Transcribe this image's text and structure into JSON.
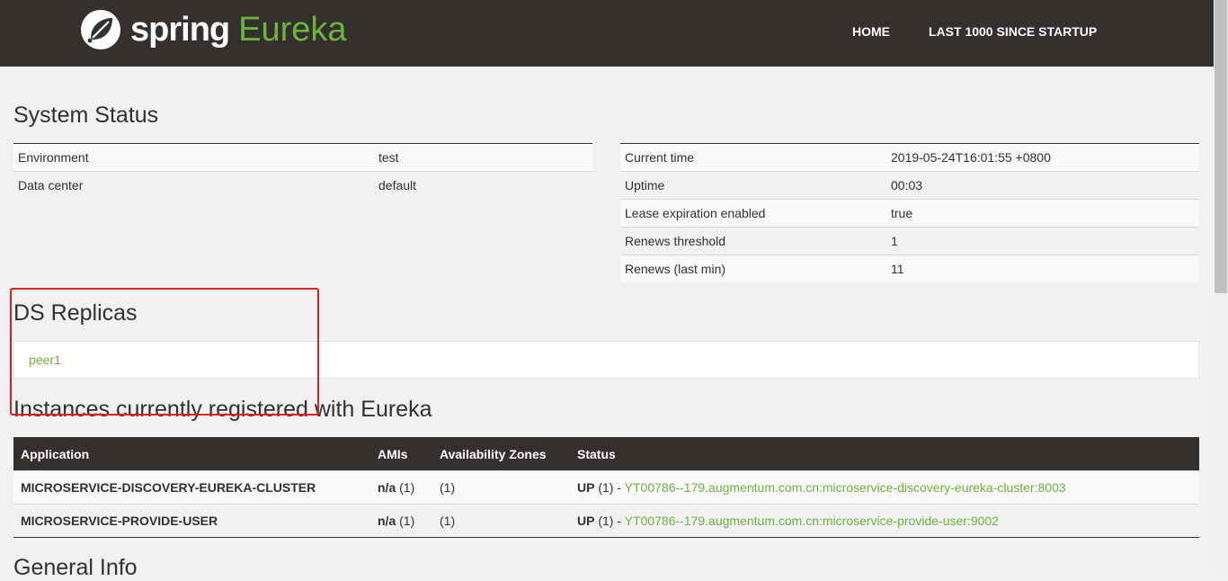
{
  "nav": {
    "brand_spring": "spring",
    "brand_eureka": "Eureka",
    "home": "HOME",
    "last1000": "LAST 1000 SINCE STARTUP"
  },
  "system_status": {
    "title": "System Status",
    "left": [
      {
        "label": "Environment",
        "value": "test"
      },
      {
        "label": "Data center",
        "value": "default"
      }
    ],
    "right": [
      {
        "label": "Current time",
        "value": "2019-05-24T16:01:55 +0800"
      },
      {
        "label": "Uptime",
        "value": "00:03"
      },
      {
        "label": "Lease expiration enabled",
        "value": "true"
      },
      {
        "label": "Renews threshold",
        "value": "1"
      },
      {
        "label": "Renews (last min)",
        "value": "11"
      }
    ]
  },
  "replicas": {
    "title": "DS Replicas",
    "items": [
      "peer1"
    ]
  },
  "instances": {
    "title": "Instances currently registered with Eureka",
    "headers": [
      "Application",
      "AMIs",
      "Availability Zones",
      "Status"
    ],
    "rows": [
      {
        "app": "MICROSERVICE-DISCOVERY-EUREKA-CLUSTER",
        "amis": "n/a",
        "amis_count": "(1)",
        "zones": "(1)",
        "status": "UP",
        "status_count": "(1) -",
        "link": "YT00786--179.augmentum.com.cn:microservice-discovery-eureka-cluster:8003"
      },
      {
        "app": "MICROSERVICE-PROVIDE-USER",
        "amis": "n/a",
        "amis_count": "(1)",
        "zones": "(1)",
        "status": "UP",
        "status_count": "(1) -",
        "link": "YT00786--179.augmentum.com.cn:microservice-provide-user:9002"
      }
    ]
  },
  "general_info": {
    "title": "General Info"
  },
  "colors": {
    "nav_bg": "#34302d",
    "accent": "#6db33f",
    "highlight": "#e0201e"
  }
}
